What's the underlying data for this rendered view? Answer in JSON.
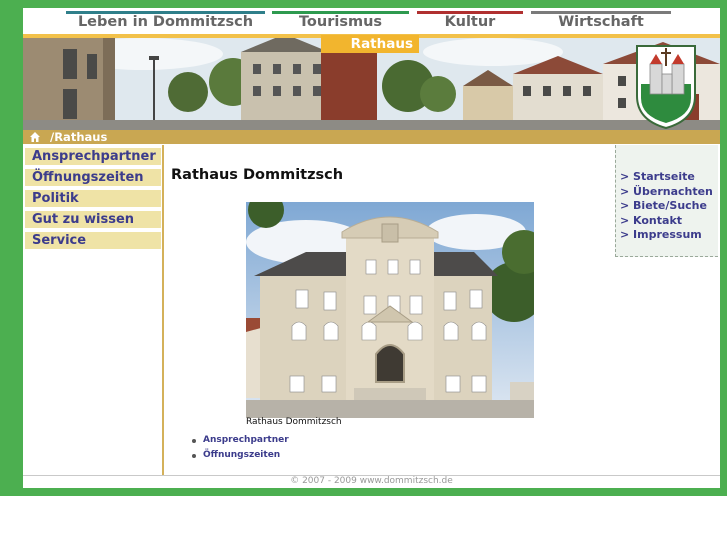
{
  "top_nav": [
    {
      "label": "Leben in Dommitzsch",
      "color": "#2f7f8a"
    },
    {
      "label": "Tourismus",
      "color": "#2e9a4f"
    },
    {
      "label": "Kultur",
      "color": "#b03030"
    },
    {
      "label": "Wirtschaft",
      "color": "#7a7a7a"
    }
  ],
  "active_section": "Rathaus",
  "breadcrumb": "/Rathaus",
  "left_nav": [
    "Ansprechpartner",
    "Öffnungszeiten",
    "Politik",
    "Gut zu wissen",
    "Service"
  ],
  "content": {
    "title": "Rathaus Dommitzsch",
    "image_caption": "Rathaus Dommitzsch",
    "links": [
      "Ansprechpartner",
      "Öffnungszeiten"
    ]
  },
  "right_links": [
    "> Startseite",
    "> Übernachten",
    "> Biete/Suche",
    "> Kontakt",
    "> Impressum"
  ],
  "footer": "© 2007 - 2009 www.dommitzsch.de",
  "colors": {
    "frame": "#4caf50",
    "accent": "#f2b52e",
    "link": "#3c3c8c",
    "menu_bg": "#efe3a6"
  }
}
